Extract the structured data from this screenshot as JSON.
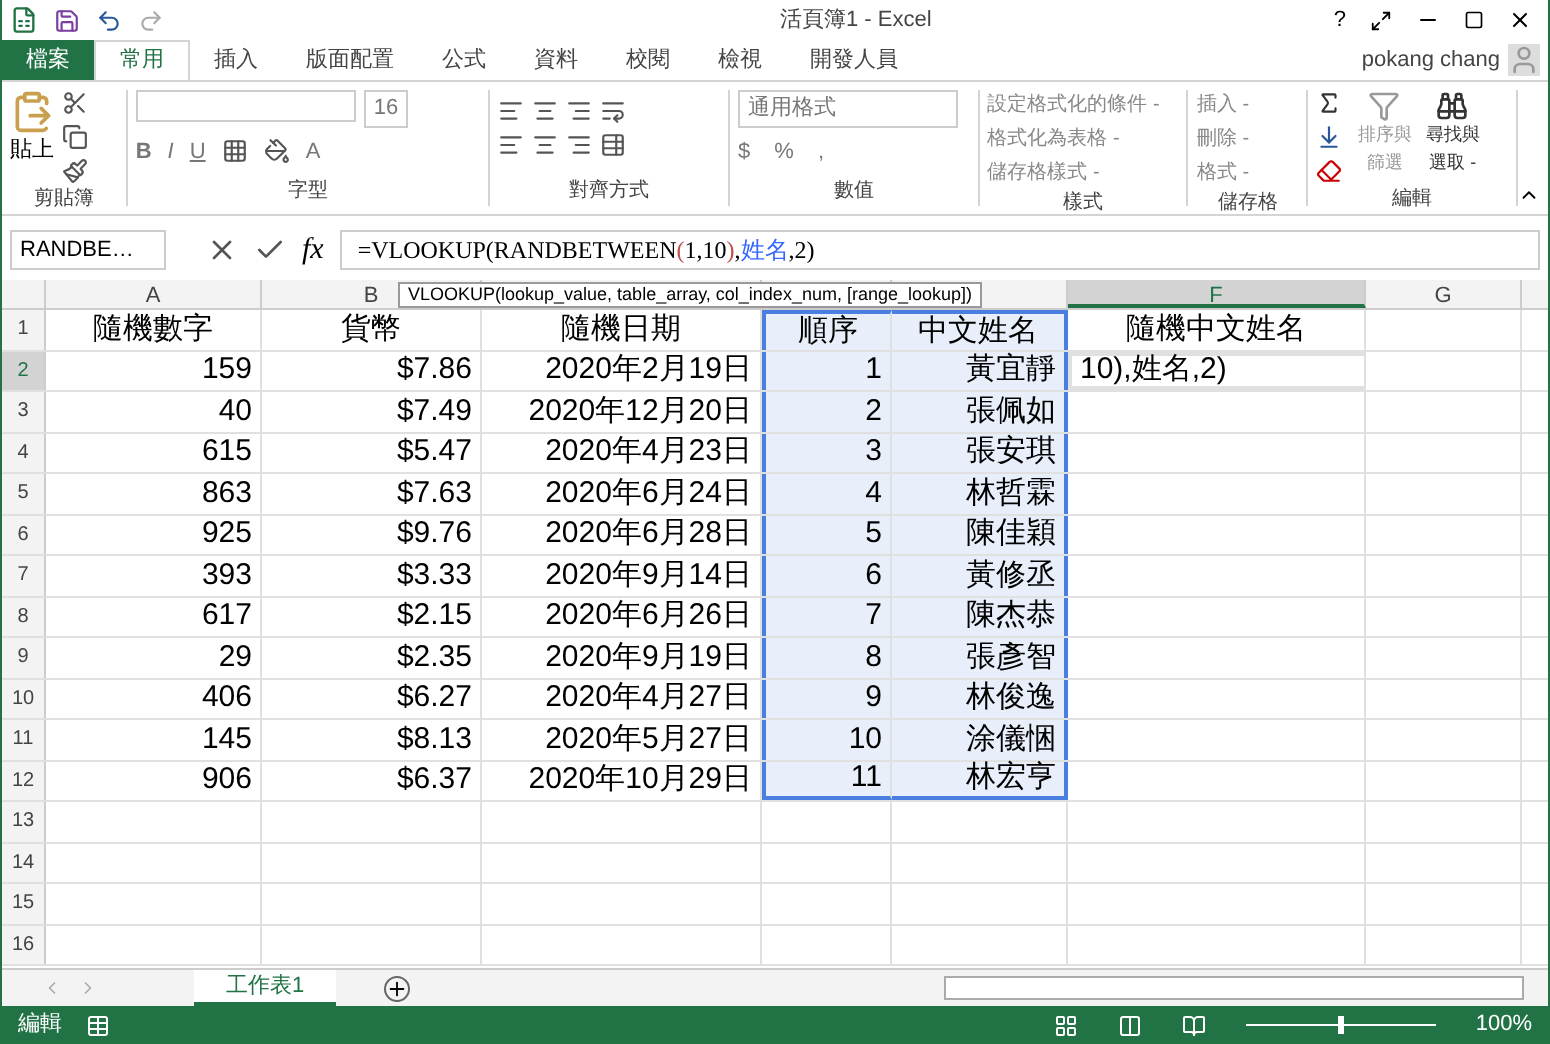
{
  "window": {
    "title": "活頁簿1 - Excel",
    "help": "?",
    "user": "pokang chang"
  },
  "tabs": [
    {
      "label": "檔案",
      "kind": "file",
      "selected": false
    },
    {
      "label": "常用",
      "kind": "tab",
      "selected": true
    },
    {
      "label": "插入",
      "kind": "tab",
      "selected": false
    },
    {
      "label": "版面配置",
      "kind": "tab",
      "selected": false
    },
    {
      "label": "公式",
      "kind": "tab",
      "selected": false
    },
    {
      "label": "資料",
      "kind": "tab",
      "selected": false
    },
    {
      "label": "校閱",
      "kind": "tab",
      "selected": false
    },
    {
      "label": "檢視",
      "kind": "tab",
      "selected": false
    },
    {
      "label": "開發人員",
      "kind": "tab",
      "selected": false
    }
  ],
  "ribbon": {
    "clipboard": {
      "paste": "貼上",
      "label": "剪貼簿"
    },
    "font": {
      "size": "16",
      "bold": "B",
      "italic": "I",
      "underline": "U",
      "font_color": "A",
      "label": "字型"
    },
    "alignment": {
      "label": "對齊方式"
    },
    "number": {
      "format": "通用格式",
      "currency": "$",
      "percent": "%",
      "comma": ",",
      "label": "數值"
    },
    "styles": {
      "items": [
        "設定格式化的條件 -",
        "格式化為表格 -",
        "儲存格樣式 -"
      ],
      "label": "樣式"
    },
    "cells": {
      "items": [
        "插入 -",
        "刪除 -",
        "格式 -"
      ],
      "label": "儲存格"
    },
    "editing": {
      "sort": "排序與篩選",
      "find": "尋找與選取 -",
      "label": "編輯"
    }
  },
  "formula_bar": {
    "name_box": "RANDBE…",
    "fx": "fx",
    "formula": [
      {
        "text": "=VLOOKUP(RANDBETWEEN",
        "color": "#000000"
      },
      {
        "text": "(",
        "color": "#c0504d"
      },
      {
        "text": "1,10",
        "color": "#000000"
      },
      {
        "text": ")",
        "color": "#c0504d"
      },
      {
        "text": ",",
        "color": "#000000"
      },
      {
        "text": "姓名",
        "color": "#3366ff"
      },
      {
        "text": ",2)",
        "color": "#000000"
      }
    ],
    "tooltip": "VLOOKUP(lookup_value, table_array, col_index_num, [range_lookup])"
  },
  "sheet": {
    "columns": [
      {
        "label": "A",
        "selected": false
      },
      {
        "label": "B",
        "selected": false
      },
      {
        "selected": false
      },
      {
        "selected": false
      },
      {
        "selected": false
      },
      {
        "label": "F",
        "selected": true
      },
      {
        "label": "G",
        "selected": false
      }
    ],
    "rows": [
      {
        "number": "1",
        "selected": false,
        "cells": [
          "隨機數字",
          "貨幣",
          "隨機日期",
          "順序",
          "中文姓名",
          "隨機中文姓名"
        ]
      },
      {
        "number": "2",
        "selected": true,
        "cells": [
          "159",
          "$7.86",
          "2020年2月19日",
          "1",
          "黃宜靜",
          "10),姓名,2)"
        ]
      },
      {
        "number": "3",
        "selected": false,
        "cells": [
          "40",
          "$7.49",
          "2020年12月20日",
          "2",
          "張佩如",
          ""
        ]
      },
      {
        "number": "4",
        "selected": false,
        "cells": [
          "615",
          "$5.47",
          "2020年4月23日",
          "3",
          "張安琪",
          ""
        ]
      },
      {
        "number": "5",
        "selected": false,
        "cells": [
          "863",
          "$7.63",
          "2020年6月24日",
          "4",
          "林哲霖",
          ""
        ]
      },
      {
        "number": "6",
        "selected": false,
        "cells": [
          "925",
          "$9.76",
          "2020年6月28日",
          "5",
          "陳佳穎",
          ""
        ]
      },
      {
        "number": "7",
        "selected": false,
        "cells": [
          "393",
          "$3.33",
          "2020年9月14日",
          "6",
          "黃修丞",
          ""
        ]
      },
      {
        "number": "8",
        "selected": false,
        "cells": [
          "617",
          "$2.15",
          "2020年6月26日",
          "7",
          "陳杰恭",
          ""
        ]
      },
      {
        "number": "9",
        "selected": false,
        "cells": [
          "29",
          "$2.35",
          "2020年9月19日",
          "8",
          "張彥智",
          ""
        ]
      },
      {
        "number": "10",
        "selected": false,
        "cells": [
          "406",
          "$6.27",
          "2020年4月27日",
          "9",
          "林俊逸",
          ""
        ]
      },
      {
        "number": "11",
        "selected": false,
        "cells": [
          "145",
          "$8.13",
          "2020年5月27日",
          "10",
          "涂儀悃",
          ""
        ]
      },
      {
        "number": "12",
        "selected": false,
        "cells": [
          "906",
          "$6.37",
          "2020年10月29日",
          "11",
          "林宏亨",
          ""
        ]
      },
      {
        "number": "13",
        "selected": false,
        "cells": [
          "",
          "",
          "",
          "",
          "",
          ""
        ]
      },
      {
        "number": "14",
        "selected": false,
        "cells": [
          "",
          "",
          "",
          "",
          "",
          ""
        ]
      },
      {
        "number": "15",
        "selected": false,
        "cells": [
          "",
          "",
          "",
          "",
          "",
          ""
        ]
      },
      {
        "number": "16",
        "selected": false,
        "cells": [
          "",
          "",
          "",
          "",
          "",
          ""
        ]
      }
    ]
  },
  "sheet_tabs": [
    {
      "label": "工作表1",
      "selected": true
    }
  ],
  "status_bar": {
    "mode": "編輯",
    "zoom": "100%",
    "zoom_slider": {
      "level": 0.5
    }
  }
}
